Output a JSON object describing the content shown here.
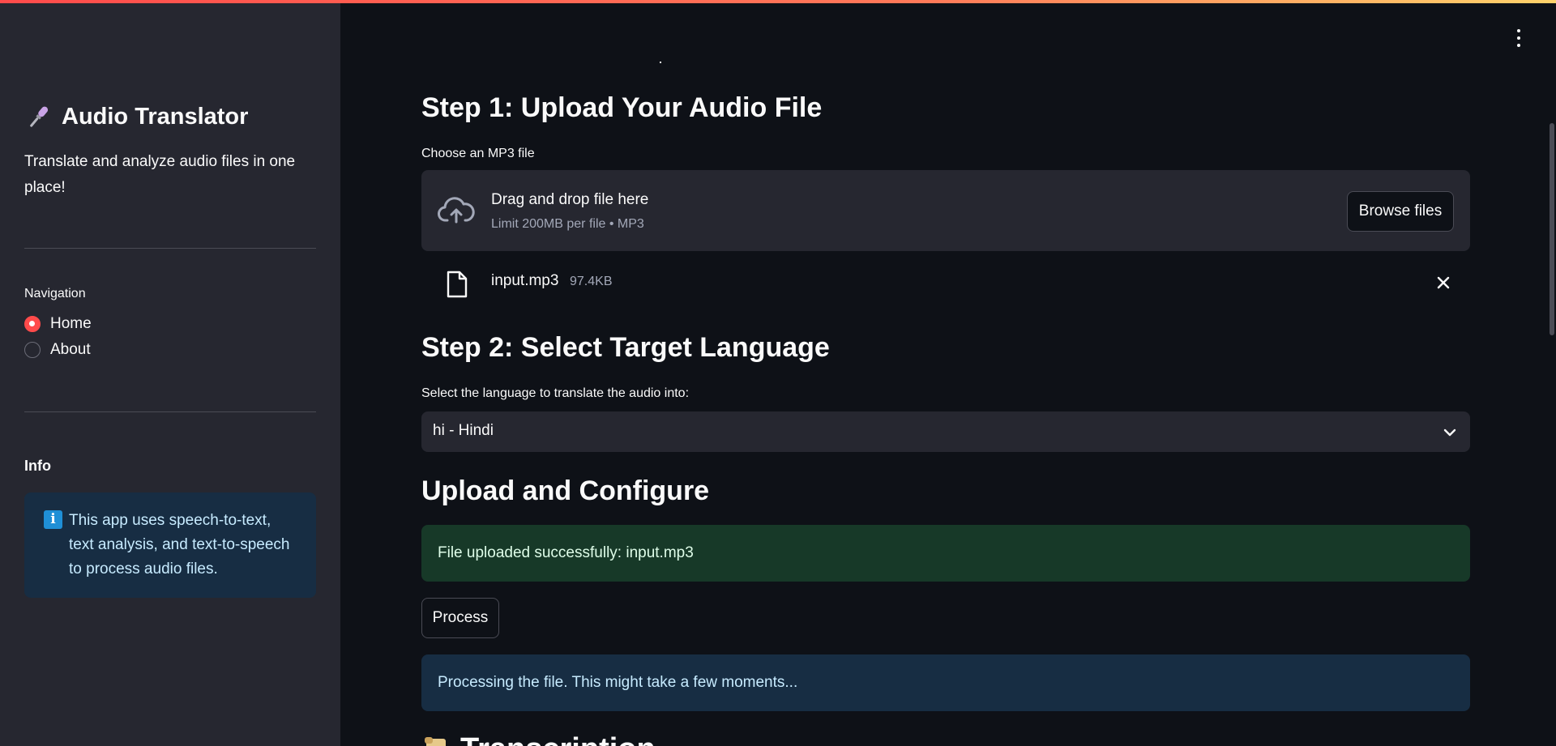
{
  "sidebar": {
    "title": "Audio Translator",
    "subtitle": "Translate and analyze audio files in one place!",
    "navigation_label": "Navigation",
    "nav_items": [
      {
        "label": "Home",
        "selected": true
      },
      {
        "label": "About",
        "selected": false
      }
    ],
    "info_heading": "Info",
    "info_text": "This app uses speech-to-text, text analysis, and text-to-speech to process audio files.",
    "icons": {
      "title": "microphone-icon",
      "info": "info-icon"
    }
  },
  "main": {
    "step1": {
      "heading": "Step 1: Upload Your Audio File",
      "label": "Choose an MP3 file",
      "dropzone_title": "Drag and drop file here",
      "dropzone_limit": "Limit 200MB per file • MP3",
      "browse_label": "Browse files",
      "uploaded_file": {
        "name": "input.mp3",
        "size": "97.4KB"
      }
    },
    "step2": {
      "heading": "Step 2: Select Target Language",
      "label": "Select the language to translate the audio into:",
      "selected_language": "hi - Hindi"
    },
    "configure": {
      "heading": "Upload and Configure",
      "success_message": "File uploaded successfully: input.mp3",
      "process_label": "Process",
      "info_message": "Processing the file. This might take a few moments..."
    },
    "next_heading": "Transcription"
  },
  "colors": {
    "accent": "#ff4b4b",
    "sidebar_bg": "#262730",
    "main_bg": "#0e1117",
    "success_bg": "#173928",
    "info_bg": "#172d43"
  }
}
